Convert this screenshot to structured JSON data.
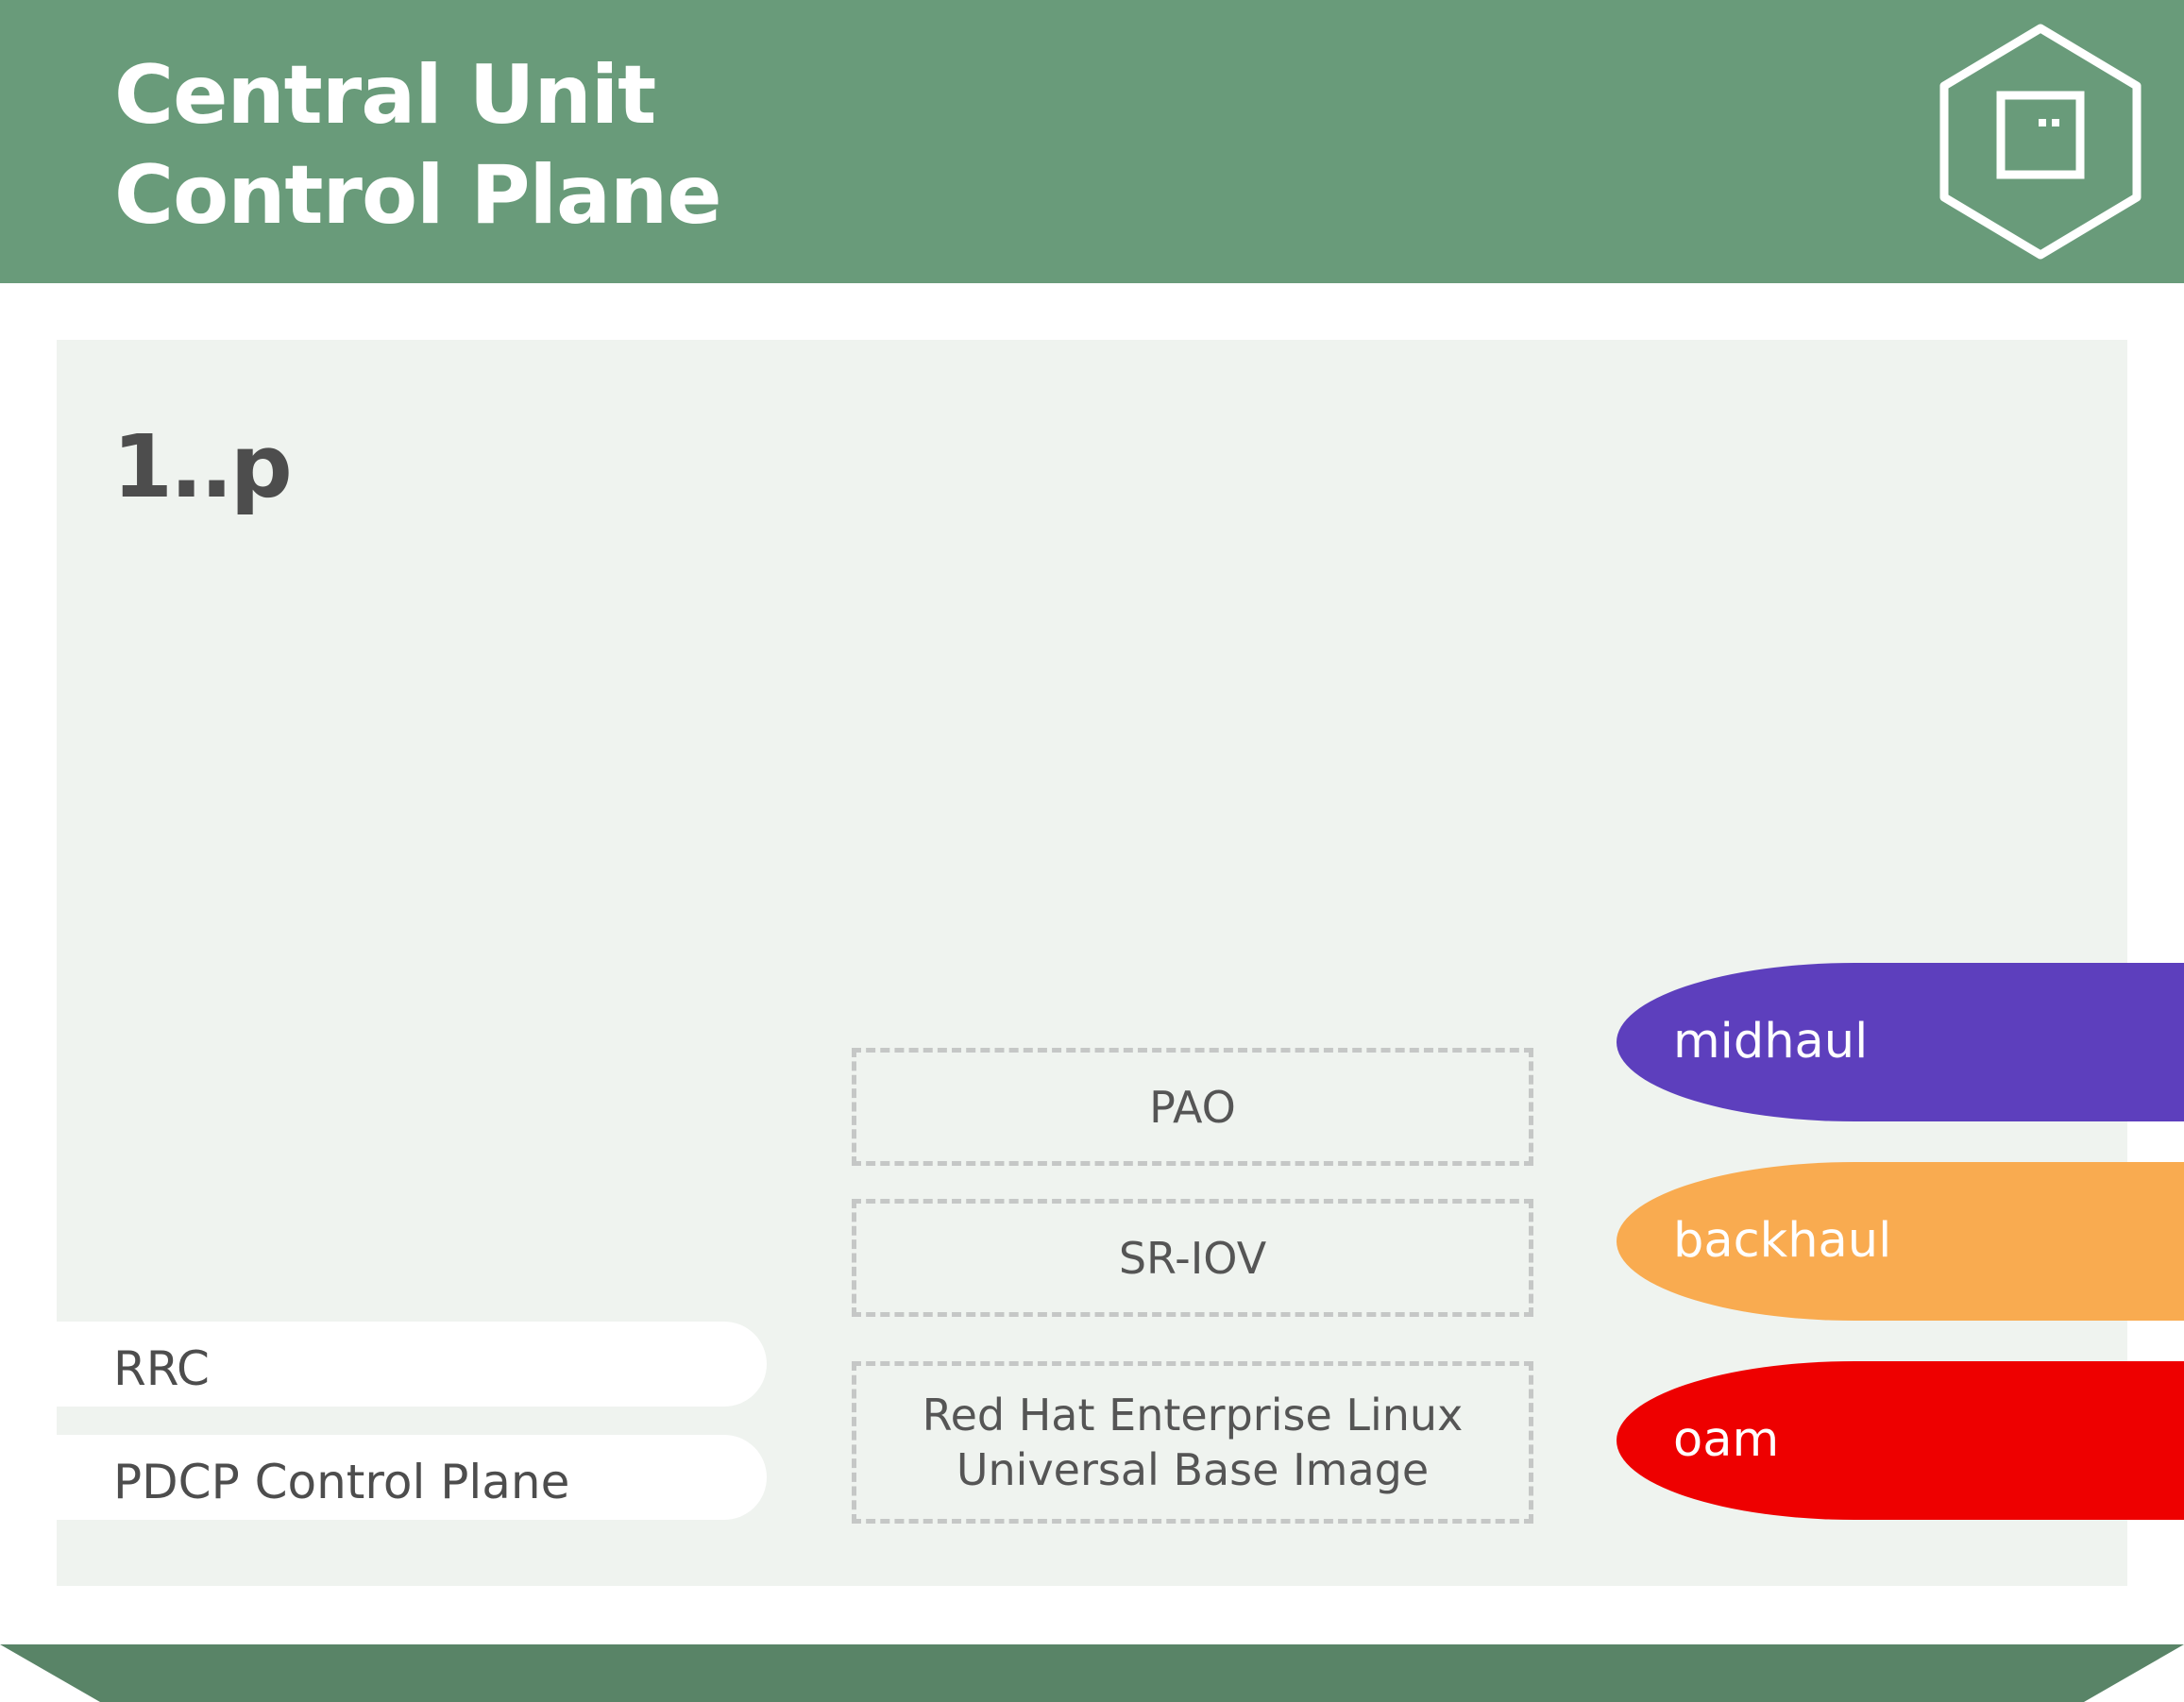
{
  "header": {
    "title_line1": "Central Unit",
    "title_line2": "Control Plane",
    "background_color": "#699b7a",
    "icon": "container-hexagon-icon"
  },
  "panel": {
    "instances_label": "1..p",
    "background_color": "#eff3ef"
  },
  "functions": {
    "rrc": "RRC",
    "pdcp": "PDCP Control Plane"
  },
  "platform": {
    "pao": "PAO",
    "sriov": "SR-IOV",
    "rhel_line1": "Red Hat Enterprise Linux",
    "rhel_line2": "Universal Base Image"
  },
  "networks": {
    "midhaul": {
      "label": "midhaul",
      "color": "#5d3fbd"
    },
    "backhaul": {
      "label": "backhaul",
      "color": "#f9ab50"
    },
    "oam": {
      "label": "oam",
      "color": "#ee0000"
    }
  },
  "footer": {
    "color": "#598467"
  }
}
